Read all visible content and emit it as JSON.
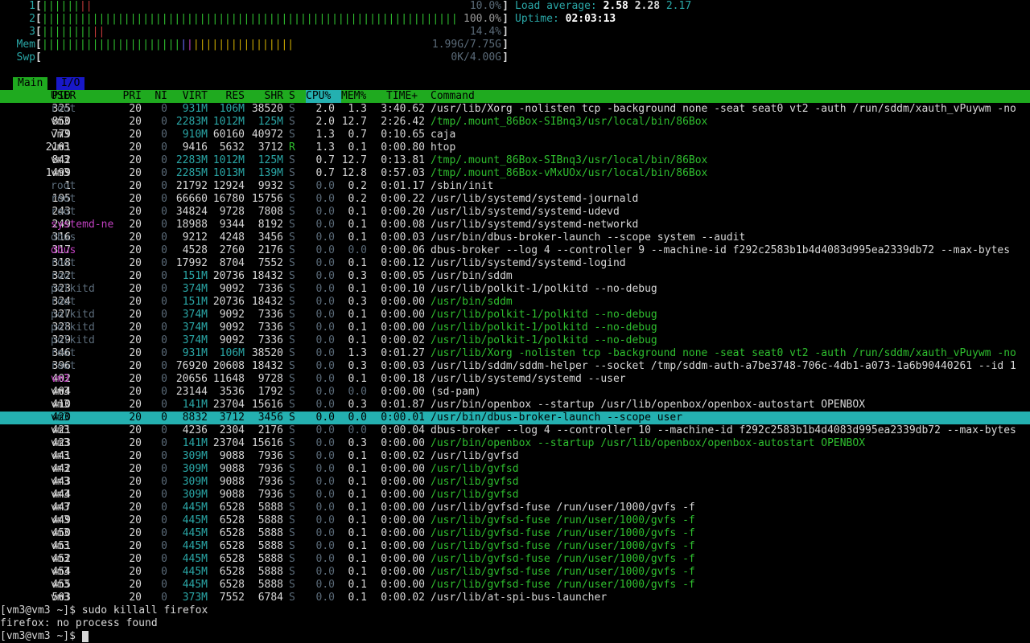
{
  "meters": [
    {
      "label": "1",
      "bar": "||||||||",
      "value": "10.0%"
    },
    {
      "label": "2",
      "bar": "|||||||||||||||||||||||||||||||||||||||||||||||||||||||||||||||||||||",
      "value": "100.0%"
    },
    {
      "label": "3",
      "bar": "||||||||||",
      "value": "14.4%"
    },
    {
      "label": "Mem",
      "bar": "||||||||||||||||||||||||||||||||||||||||",
      "value": "1.99G/7.75G"
    },
    {
      "label": "Swp",
      "bar": "",
      "value": "0K/4.00G"
    }
  ],
  "sysinfo": {
    "load_label": "Load average:",
    "load1": "2.58",
    "load5": "2.28",
    "load15": "2.17",
    "uptime_label": "Uptime:",
    "uptime": "02:03:13"
  },
  "tabs": [
    {
      "label": "Main"
    },
    {
      "label": "I/O"
    }
  ],
  "header": {
    "pid": "PID",
    "user": "USER",
    "pri": "PRI",
    "ni": "NI",
    "virt": "VIRT",
    "res": "RES",
    "shr": "SHR",
    "s": "S",
    "cpu": "CPU%",
    "mem": "MEM%",
    "time": "TIME+",
    "command": "Command"
  },
  "rows": [
    {
      "pid": "325",
      "user": "root",
      "pri": "20",
      "ni": "0",
      "virt": "931M",
      "res": "106M",
      "shr": "38520",
      "s": "S",
      "cpu": "2.0",
      "mem": "1.3",
      "time": "3:40.62",
      "cmd": "/usr/lib/Xorg -nolisten tcp -background none -seat seat0 vt2 -auth /run/sddm/xauth_vPuywm -no",
      "thread": false
    },
    {
      "pid": "850",
      "user": "vm3",
      "pri": "20",
      "ni": "0",
      "virt": "2283M",
      "res": "1012M",
      "shr": "125M",
      "s": "S",
      "cpu": "2.0",
      "mem": "12.7",
      "time": "2:26.42",
      "cmd": "/tmp/.mount_86Box-SIBnq3/usr/local/bin/86Box",
      "thread": true
    },
    {
      "pid": "779",
      "user": "vm3",
      "pri": "20",
      "ni": "0",
      "virt": "910M",
      "res": "60160",
      "shr": "40972",
      "s": "S",
      "cpu": "1.3",
      "mem": "0.7",
      "time": "0:10.65",
      "cmd": "caja",
      "thread": false
    },
    {
      "pid": "2101",
      "user": "vm3",
      "pri": "20",
      "ni": "0",
      "virt": "9416",
      "res": "5632",
      "shr": "3712",
      "s": "R",
      "cpu": "1.3",
      "mem": "0.1",
      "time": "0:00.80",
      "cmd": "htop",
      "thread": false
    },
    {
      "pid": "842",
      "user": "vm3",
      "pri": "20",
      "ni": "0",
      "virt": "2283M",
      "res": "1012M",
      "shr": "125M",
      "s": "S",
      "cpu": "0.7",
      "mem": "12.7",
      "time": "0:13.81",
      "cmd": "/tmp/.mount_86Box-SIBnq3/usr/local/bin/86Box",
      "thread": true
    },
    {
      "pid": "1499",
      "user": "vm3",
      "pri": "20",
      "ni": "0",
      "virt": "2285M",
      "res": "1013M",
      "shr": "139M",
      "s": "S",
      "cpu": "0.7",
      "mem": "12.8",
      "time": "0:57.03",
      "cmd": "/tmp/.mount_86Box-vMxUOx/usr/local/bin/86Box",
      "thread": true
    },
    {
      "pid": "1",
      "user": "root",
      "pri": "20",
      "ni": "0",
      "virt": "21792",
      "res": "12924",
      "shr": "9932",
      "s": "S",
      "cpu": "0.0",
      "mem": "0.2",
      "time": "0:01.17",
      "cmd": "/sbin/init",
      "thread": false
    },
    {
      "pid": "195",
      "user": "root",
      "pri": "20",
      "ni": "0",
      "virt": "66660",
      "res": "16780",
      "shr": "15756",
      "s": "S",
      "cpu": "0.0",
      "mem": "0.2",
      "time": "0:00.22",
      "cmd": "/usr/lib/systemd/systemd-journald",
      "thread": false
    },
    {
      "pid": "243",
      "user": "root",
      "pri": "20",
      "ni": "0",
      "virt": "34824",
      "res": "9728",
      "shr": "7808",
      "s": "S",
      "cpu": "0.0",
      "mem": "0.1",
      "time": "0:00.20",
      "cmd": "/usr/lib/systemd/systemd-udevd",
      "thread": false
    },
    {
      "pid": "249",
      "user": "systemd-ne",
      "pri": "20",
      "ni": "0",
      "virt": "18988",
      "res": "9344",
      "shr": "8192",
      "s": "S",
      "cpu": "0.0",
      "mem": "0.1",
      "time": "0:00.08",
      "cmd": "/usr/lib/systemd/systemd-networkd",
      "thread": false,
      "ucolor": "m"
    },
    {
      "pid": "316",
      "user": "dbus",
      "pri": "20",
      "ni": "0",
      "virt": "9212",
      "res": "4248",
      "shr": "3456",
      "s": "S",
      "cpu": "0.0",
      "mem": "0.1",
      "time": "0:00.03",
      "cmd": "/usr/bin/dbus-broker-launch --scope system --audit",
      "thread": false
    },
    {
      "pid": "317",
      "user": "dbus",
      "pri": "20",
      "ni": "0",
      "virt": "4528",
      "res": "2760",
      "shr": "2176",
      "s": "S",
      "cpu": "0.0",
      "mem": "0.0",
      "time": "0:00.06",
      "cmd": "dbus-broker --log 4 --controller 9 --machine-id f292c2583b1b4d4083d995ea2339db72 --max-bytes",
      "thread": false,
      "ucolor": "m"
    },
    {
      "pid": "318",
      "user": "root",
      "pri": "20",
      "ni": "0",
      "virt": "17992",
      "res": "8704",
      "shr": "7552",
      "s": "S",
      "cpu": "0.0",
      "mem": "0.1",
      "time": "0:00.12",
      "cmd": "/usr/lib/systemd/systemd-logind",
      "thread": false
    },
    {
      "pid": "322",
      "user": "root",
      "pri": "20",
      "ni": "0",
      "virt": "151M",
      "res": "20736",
      "shr": "18432",
      "s": "S",
      "cpu": "0.0",
      "mem": "0.3",
      "time": "0:00.05",
      "cmd": "/usr/bin/sddm",
      "thread": false
    },
    {
      "pid": "323",
      "user": "polkitd",
      "pri": "20",
      "ni": "0",
      "virt": "374M",
      "res": "9092",
      "shr": "7336",
      "s": "S",
      "cpu": "0.0",
      "mem": "0.1",
      "time": "0:00.10",
      "cmd": "/usr/lib/polkit-1/polkitd --no-debug",
      "thread": false
    },
    {
      "pid": "324",
      "user": "root",
      "pri": "20",
      "ni": "0",
      "virt": "151M",
      "res": "20736",
      "shr": "18432",
      "s": "S",
      "cpu": "0.0",
      "mem": "0.3",
      "time": "0:00.00",
      "cmd": "/usr/bin/sddm",
      "thread": true
    },
    {
      "pid": "327",
      "user": "polkitd",
      "pri": "20",
      "ni": "0",
      "virt": "374M",
      "res": "9092",
      "shr": "7336",
      "s": "S",
      "cpu": "0.0",
      "mem": "0.1",
      "time": "0:00.00",
      "cmd": "/usr/lib/polkit-1/polkitd --no-debug",
      "thread": true
    },
    {
      "pid": "328",
      "user": "polkitd",
      "pri": "20",
      "ni": "0",
      "virt": "374M",
      "res": "9092",
      "shr": "7336",
      "s": "S",
      "cpu": "0.0",
      "mem": "0.1",
      "time": "0:00.00",
      "cmd": "/usr/lib/polkit-1/polkitd --no-debug",
      "thread": true
    },
    {
      "pid": "329",
      "user": "polkitd",
      "pri": "20",
      "ni": "0",
      "virt": "374M",
      "res": "9092",
      "shr": "7336",
      "s": "S",
      "cpu": "0.0",
      "mem": "0.1",
      "time": "0:00.02",
      "cmd": "/usr/lib/polkit-1/polkitd --no-debug",
      "thread": true
    },
    {
      "pid": "346",
      "user": "root",
      "pri": "20",
      "ni": "0",
      "virt": "931M",
      "res": "106M",
      "shr": "38520",
      "s": "S",
      "cpu": "0.0",
      "mem": "1.3",
      "time": "0:01.27",
      "cmd": "/usr/lib/Xorg -nolisten tcp -background none -seat seat0 vt2 -auth /run/sddm/xauth_vPuywm -no",
      "thread": true
    },
    {
      "pid": "396",
      "user": "root",
      "pri": "20",
      "ni": "0",
      "virt": "76920",
      "res": "20608",
      "shr": "18432",
      "s": "S",
      "cpu": "0.0",
      "mem": "0.3",
      "time": "0:00.03",
      "cmd": "/usr/lib/sddm/sddm-helper --socket /tmp/sddm-auth-a7be3748-706c-4db1-a073-1a6b90440261 --id 1",
      "thread": false
    },
    {
      "pid": "402",
      "user": "vm3",
      "pri": "20",
      "ni": "0",
      "virt": "20656",
      "res": "11648",
      "shr": "9728",
      "s": "S",
      "cpu": "0.0",
      "mem": "0.1",
      "time": "0:00.18",
      "cmd": "/usr/lib/systemd/systemd --user",
      "thread": false,
      "ucolor": "m"
    },
    {
      "pid": "404",
      "user": "vm3",
      "pri": "20",
      "ni": "0",
      "virt": "23144",
      "res": "3536",
      "shr": "1792",
      "s": "S",
      "cpu": "0.0",
      "mem": "0.0",
      "time": "0:00.00",
      "cmd": "(sd-pam)",
      "thread": false
    },
    {
      "pid": "410",
      "user": "vm3",
      "pri": "20",
      "ni": "0",
      "virt": "141M",
      "res": "23704",
      "shr": "15616",
      "s": "S",
      "cpu": "0.0",
      "mem": "0.3",
      "time": "0:01.87",
      "cmd": "/usr/bin/openbox --startup /usr/lib/openbox/openbox-autostart OPENBOX",
      "thread": false
    },
    {
      "pid": "420",
      "user": "vm3",
      "pri": "20",
      "ni": "0",
      "virt": "8832",
      "res": "3712",
      "shr": "3456",
      "s": "S",
      "cpu": "0.0",
      "mem": "0.0",
      "time": "0:00.01",
      "cmd": "/usr/bin/dbus-broker-launch --scope user",
      "thread": false,
      "selected": true
    },
    {
      "pid": "421",
      "user": "vm3",
      "pri": "20",
      "ni": "0",
      "virt": "4236",
      "res": "2304",
      "shr": "2176",
      "s": "S",
      "cpu": "0.0",
      "mem": "0.0",
      "time": "0:00.04",
      "cmd": "dbus-broker --log 4 --controller 10 --machine-id f292c2583b1b4d4083d995ea2339db72 --max-bytes",
      "thread": false
    },
    {
      "pid": "423",
      "user": "vm3",
      "pri": "20",
      "ni": "0",
      "virt": "141M",
      "res": "23704",
      "shr": "15616",
      "s": "S",
      "cpu": "0.0",
      "mem": "0.3",
      "time": "0:00.00",
      "cmd": "/usr/bin/openbox --startup /usr/lib/openbox/openbox-autostart OPENBOX",
      "thread": true
    },
    {
      "pid": "441",
      "user": "vm3",
      "pri": "20",
      "ni": "0",
      "virt": "309M",
      "res": "9088",
      "shr": "7936",
      "s": "S",
      "cpu": "0.0",
      "mem": "0.1",
      "time": "0:00.02",
      "cmd": "/usr/lib/gvfsd",
      "thread": false
    },
    {
      "pid": "442",
      "user": "vm3",
      "pri": "20",
      "ni": "0",
      "virt": "309M",
      "res": "9088",
      "shr": "7936",
      "s": "S",
      "cpu": "0.0",
      "mem": "0.1",
      "time": "0:00.00",
      "cmd": "/usr/lib/gvfsd",
      "thread": true
    },
    {
      "pid": "443",
      "user": "vm3",
      "pri": "20",
      "ni": "0",
      "virt": "309M",
      "res": "9088",
      "shr": "7936",
      "s": "S",
      "cpu": "0.0",
      "mem": "0.1",
      "time": "0:00.00",
      "cmd": "/usr/lib/gvfsd",
      "thread": true
    },
    {
      "pid": "444",
      "user": "vm3",
      "pri": "20",
      "ni": "0",
      "virt": "309M",
      "res": "9088",
      "shr": "7936",
      "s": "S",
      "cpu": "0.0",
      "mem": "0.1",
      "time": "0:00.00",
      "cmd": "/usr/lib/gvfsd",
      "thread": true
    },
    {
      "pid": "447",
      "user": "vm3",
      "pri": "20",
      "ni": "0",
      "virt": "445M",
      "res": "6528",
      "shr": "5888",
      "s": "S",
      "cpu": "0.0",
      "mem": "0.1",
      "time": "0:00.00",
      "cmd": "/usr/lib/gvfsd-fuse /run/user/1000/gvfs -f",
      "thread": false
    },
    {
      "pid": "449",
      "user": "vm3",
      "pri": "20",
      "ni": "0",
      "virt": "445M",
      "res": "6528",
      "shr": "5888",
      "s": "S",
      "cpu": "0.0",
      "mem": "0.1",
      "time": "0:00.00",
      "cmd": "/usr/lib/gvfsd-fuse /run/user/1000/gvfs -f",
      "thread": true
    },
    {
      "pid": "450",
      "user": "vm3",
      "pri": "20",
      "ni": "0",
      "virt": "445M",
      "res": "6528",
      "shr": "5888",
      "s": "S",
      "cpu": "0.0",
      "mem": "0.1",
      "time": "0:00.00",
      "cmd": "/usr/lib/gvfsd-fuse /run/user/1000/gvfs -f",
      "thread": true
    },
    {
      "pid": "451",
      "user": "vm3",
      "pri": "20",
      "ni": "0",
      "virt": "445M",
      "res": "6528",
      "shr": "5888",
      "s": "S",
      "cpu": "0.0",
      "mem": "0.1",
      "time": "0:00.00",
      "cmd": "/usr/lib/gvfsd-fuse /run/user/1000/gvfs -f",
      "thread": true
    },
    {
      "pid": "452",
      "user": "vm3",
      "pri": "20",
      "ni": "0",
      "virt": "445M",
      "res": "6528",
      "shr": "5888",
      "s": "S",
      "cpu": "0.0",
      "mem": "0.1",
      "time": "0:00.00",
      "cmd": "/usr/lib/gvfsd-fuse /run/user/1000/gvfs -f",
      "thread": true
    },
    {
      "pid": "454",
      "user": "vm3",
      "pri": "20",
      "ni": "0",
      "virt": "445M",
      "res": "6528",
      "shr": "5888",
      "s": "S",
      "cpu": "0.0",
      "mem": "0.1",
      "time": "0:00.00",
      "cmd": "/usr/lib/gvfsd-fuse /run/user/1000/gvfs -f",
      "thread": true
    },
    {
      "pid": "455",
      "user": "vm3",
      "pri": "20",
      "ni": "0",
      "virt": "445M",
      "res": "6528",
      "shr": "5888",
      "s": "S",
      "cpu": "0.0",
      "mem": "0.1",
      "time": "0:00.00",
      "cmd": "/usr/lib/gvfsd-fuse /run/user/1000/gvfs -f",
      "thread": true
    },
    {
      "pid": "503",
      "user": "vm3",
      "pri": "20",
      "ni": "0",
      "virt": "373M",
      "res": "7552",
      "shr": "6784",
      "s": "S",
      "cpu": "0.0",
      "mem": "0.1",
      "time": "0:00.02",
      "cmd": "/usr/lib/at-spi-bus-launcher",
      "thread": false
    }
  ],
  "shell": [
    {
      "prompt": "[vm3@vm3 ~]$",
      "text": " sudo killall firefox"
    },
    {
      "prompt": "",
      "text": "firefox: no process found"
    },
    {
      "prompt": "[vm3@vm3 ~]$",
      "text": ""
    }
  ]
}
